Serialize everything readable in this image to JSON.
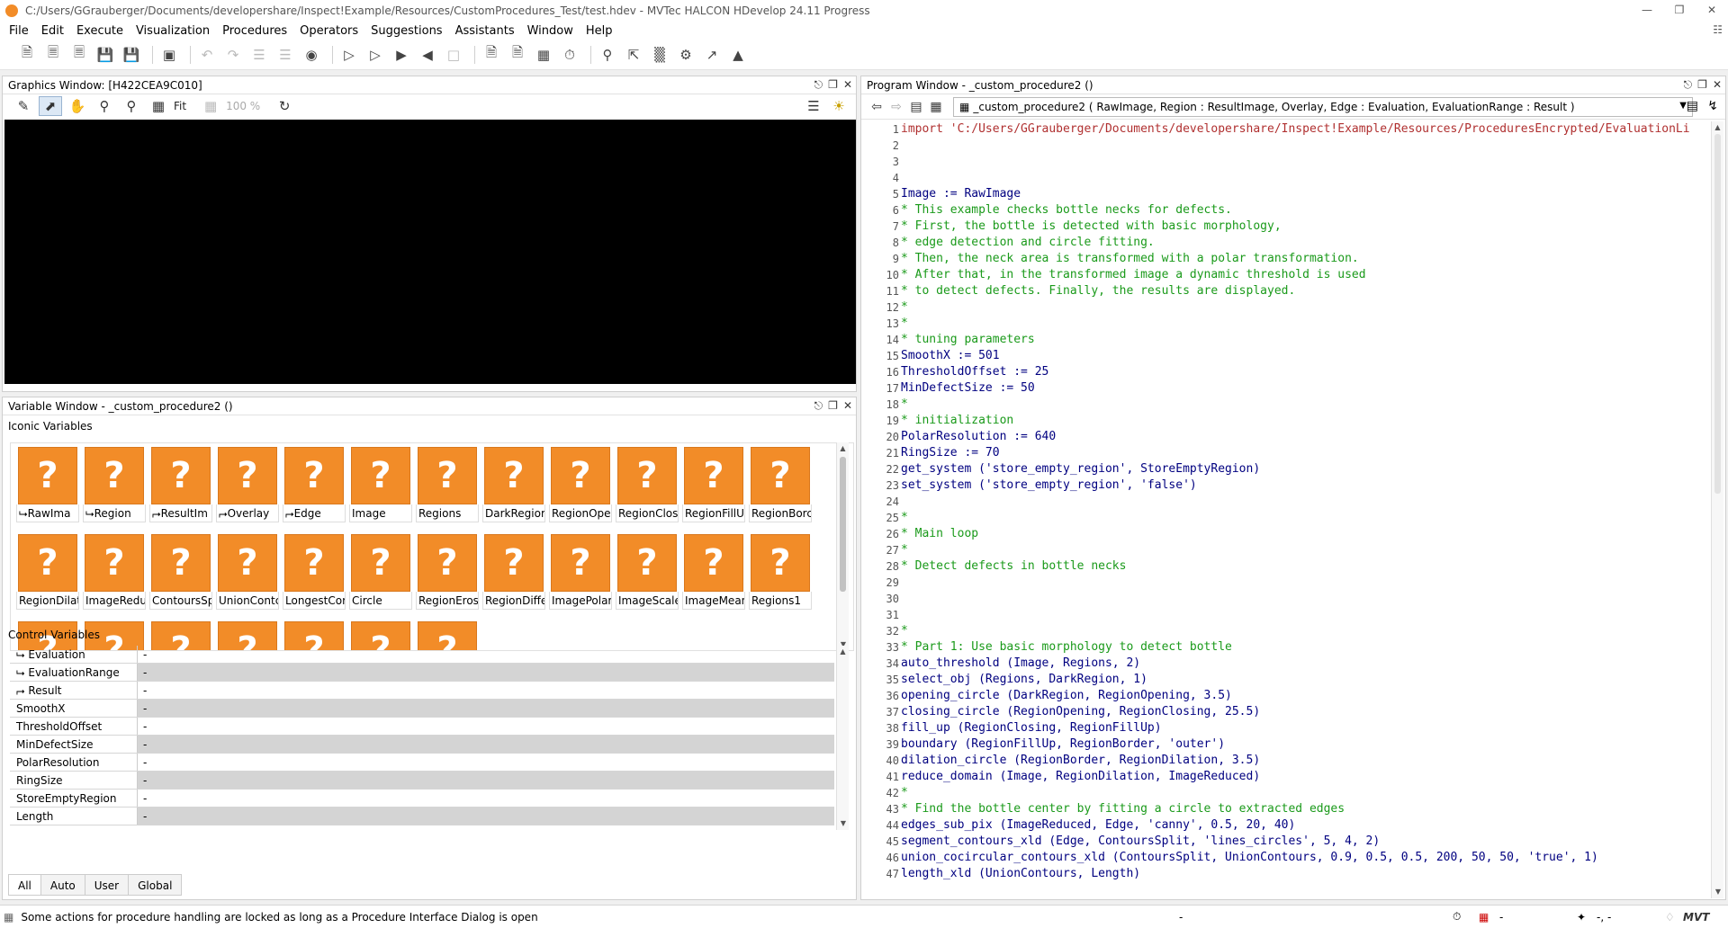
{
  "window": {
    "title": "C:/Users/GGrauberger/Documents/developershare/Inspect!Example/Resources/CustomProcedures_Test/test.hdev - MVTec HALCON HDevelop 24.11 Progress",
    "controls": [
      "—",
      "❐",
      "✕"
    ]
  },
  "menu": [
    "File",
    "Edit",
    "Execute",
    "Visualization",
    "Procedures",
    "Operators",
    "Suggestions",
    "Assistants",
    "Window",
    "Help"
  ],
  "graphics": {
    "title": "Graphics Window: [H422CEA9C010]",
    "fit_label": "Fit",
    "zoom_label": "100 %"
  },
  "variables": {
    "title": "Variable Window - _custom_procedure2 ()",
    "iconic_header": "Iconic Variables",
    "iconic": [
      "⮡RawIma",
      "⮡Region",
      "⮣ResultIm",
      "⮣Overlay",
      "⮣Edge",
      "Image",
      "Regions",
      "DarkRegior",
      "RegionOpe",
      "RegionClos",
      "RegionFillU",
      "RegionBorc",
      "RegionDilat",
      "ImageRedu",
      "ContoursSp",
      "UnionContc",
      "LongestCor",
      "Circle",
      "RegionEros",
      "RegionDiffe",
      "ImagePolar",
      "ImageScale",
      "ImageMean",
      "Regions1",
      "",
      "",
      "",
      "",
      "",
      "",
      ""
    ],
    "icon_glyph": "?",
    "control_header": "Control Variables",
    "control": [
      {
        "name": "⮡ Evaluation",
        "value": "-"
      },
      {
        "name": "⮡ EvaluationRange",
        "value": "-"
      },
      {
        "name": "⮣ Result",
        "value": "-"
      },
      {
        "name": "SmoothX",
        "value": "-"
      },
      {
        "name": "ThresholdOffset",
        "value": "-"
      },
      {
        "name": "MinDefectSize",
        "value": "-"
      },
      {
        "name": "PolarResolution",
        "value": "-"
      },
      {
        "name": "RingSize",
        "value": "-"
      },
      {
        "name": "StoreEmptyRegion",
        "value": "-"
      },
      {
        "name": "Length",
        "value": "-"
      }
    ],
    "tabs": [
      "All",
      "Auto",
      "User",
      "Global"
    ]
  },
  "program": {
    "title": "Program Window - _custom_procedure2 ()",
    "procedure_signature": "_custom_procedure2 ( RawImage, Region : ResultImage, Overlay, Edge : Evaluation, EvaluationRange : Result )",
    "lines": [
      {
        "n": "1",
        "t": "import 'C:/Users/GGrauberger/Documents/developershare/Inspect!Example/Resources/ProceduresEncrypted/EvaluationLi",
        "k": "import"
      },
      {
        "n": "2",
        "t": "",
        "k": ""
      },
      {
        "n": "3",
        "t": "",
        "k": ""
      },
      {
        "n": "4",
        "t": "",
        "k": ""
      },
      {
        "n": "5",
        "t": "Image := RawImage",
        "k": "op"
      },
      {
        "n": "6",
        "t": "* This example checks bottle necks for defects.",
        "k": "comment"
      },
      {
        "n": "7",
        "t": "* First, the bottle is detected with basic morphology,",
        "k": "comment"
      },
      {
        "n": "8",
        "t": "* edge detection and circle fitting.",
        "k": "comment"
      },
      {
        "n": "9",
        "t": "* Then, the neck area is transformed with a polar transformation.",
        "k": "comment"
      },
      {
        "n": "10",
        "t": "* After that, in the transformed image a dynamic threshold is used",
        "k": "comment"
      },
      {
        "n": "11",
        "t": "* to detect defects. Finally, the results are displayed.",
        "k": "comment"
      },
      {
        "n": "12",
        "t": "*",
        "k": "comment"
      },
      {
        "n": "13",
        "t": "*",
        "k": "comment"
      },
      {
        "n": "14",
        "t": "* tuning parameters",
        "k": "comment"
      },
      {
        "n": "15",
        "t": "SmoothX := 501",
        "k": "op"
      },
      {
        "n": "16",
        "t": "ThresholdOffset := 25",
        "k": "op"
      },
      {
        "n": "17",
        "t": "MinDefectSize := 50",
        "k": "op"
      },
      {
        "n": "18",
        "t": "*",
        "k": "comment"
      },
      {
        "n": "19",
        "t": "* initialization",
        "k": "comment"
      },
      {
        "n": "20",
        "t": "PolarResolution := 640",
        "k": "op"
      },
      {
        "n": "21",
        "t": "RingSize := 70",
        "k": "op"
      },
      {
        "n": "22",
        "t": "get_system ('store_empty_region', StoreEmptyRegion)",
        "k": "op"
      },
      {
        "n": "23",
        "t": "set_system ('store_empty_region', 'false')",
        "k": "op"
      },
      {
        "n": "24",
        "t": "",
        "k": ""
      },
      {
        "n": "25",
        "t": "*",
        "k": "comment"
      },
      {
        "n": "26",
        "t": "* Main loop",
        "k": "comment"
      },
      {
        "n": "27",
        "t": "*",
        "k": "comment"
      },
      {
        "n": "28",
        "t": "* Detect defects in bottle necks",
        "k": "comment"
      },
      {
        "n": "29",
        "t": "",
        "k": ""
      },
      {
        "n": "30",
        "t": "",
        "k": ""
      },
      {
        "n": "31",
        "t": "",
        "k": ""
      },
      {
        "n": "32",
        "t": "*",
        "k": "comment"
      },
      {
        "n": "33",
        "t": "* Part 1: Use basic morphology to detect bottle",
        "k": "comment"
      },
      {
        "n": "34",
        "t": "auto_threshold (Image, Regions, 2)",
        "k": "op"
      },
      {
        "n": "35",
        "t": "select_obj (Regions, DarkRegion, 1)",
        "k": "op"
      },
      {
        "n": "36",
        "t": "opening_circle (DarkRegion, RegionOpening, 3.5)",
        "k": "op"
      },
      {
        "n": "37",
        "t": "closing_circle (RegionOpening, RegionClosing, 25.5)",
        "k": "op"
      },
      {
        "n": "38",
        "t": "fill_up (RegionClosing, RegionFillUp)",
        "k": "op"
      },
      {
        "n": "39",
        "t": "boundary (RegionFillUp, RegionBorder, 'outer')",
        "k": "op"
      },
      {
        "n": "40",
        "t": "dilation_circle (RegionBorder, RegionDilation, 3.5)",
        "k": "op"
      },
      {
        "n": "41",
        "t": "reduce_domain (Image, RegionDilation, ImageReduced)",
        "k": "op"
      },
      {
        "n": "42",
        "t": "*",
        "k": "comment"
      },
      {
        "n": "43",
        "t": "* Find the bottle center by fitting a circle to extracted edges",
        "k": "comment"
      },
      {
        "n": "44",
        "t": "edges_sub_pix (ImageReduced, Edge, 'canny', 0.5, 20, 40)",
        "k": "op"
      },
      {
        "n": "45",
        "t": "segment_contours_xld (Edge, ContoursSplit, 'lines_circles', 5, 4, 2)",
        "k": "op"
      },
      {
        "n": "46",
        "t": "union_cocircular_contours_xld (ContoursSplit, UnionContours, 0.9, 0.5, 0.5, 200, 50, 50, 'true', 1)",
        "k": "op"
      },
      {
        "n": "47",
        "t": "length_xld (UnionContours, Length)",
        "k": "op"
      }
    ]
  },
  "status": {
    "message": "Some actions for procedure handling are locked as long as a Procedure Interface Dialog is open",
    "mid": "-",
    "right1": "-",
    "right2": "-, -",
    "logo": "MVTec"
  },
  "colors": {
    "accent_icon": "#f28c28",
    "comment": "#1a9a1a",
    "import": "#b03030"
  }
}
